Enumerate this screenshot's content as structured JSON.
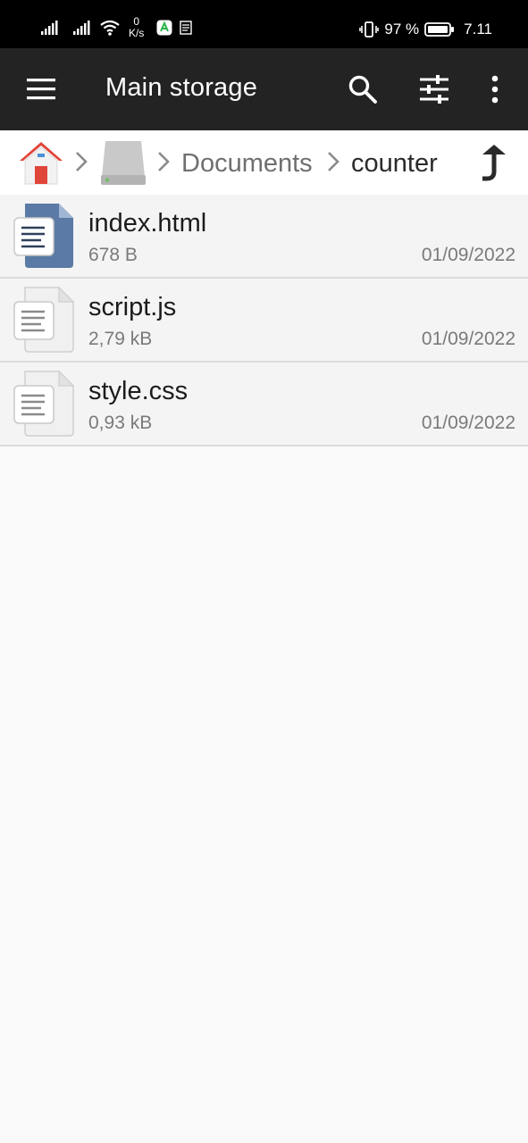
{
  "status_bar": {
    "net_speed_value": "0",
    "net_speed_unit": "K/s",
    "battery": "97 %",
    "time": "7.11"
  },
  "app_bar": {
    "title": "Main storage"
  },
  "breadcrumb": {
    "items": [
      "Documents",
      "counter"
    ]
  },
  "files": [
    {
      "name": "index.html",
      "size": "678 B",
      "date": "01/09/2022",
      "icon": "html-file-icon"
    },
    {
      "name": "script.js",
      "size": "2,79 kB",
      "date": "01/09/2022",
      "icon": "text-file-icon"
    },
    {
      "name": "style.css",
      "size": "0,93 kB",
      "date": "01/09/2022",
      "icon": "text-file-icon"
    }
  ],
  "colors": {
    "app_bar": "#232323",
    "status_bar": "#000000",
    "background": "#f9f9f9",
    "html_icon": "#5b7aa5"
  }
}
